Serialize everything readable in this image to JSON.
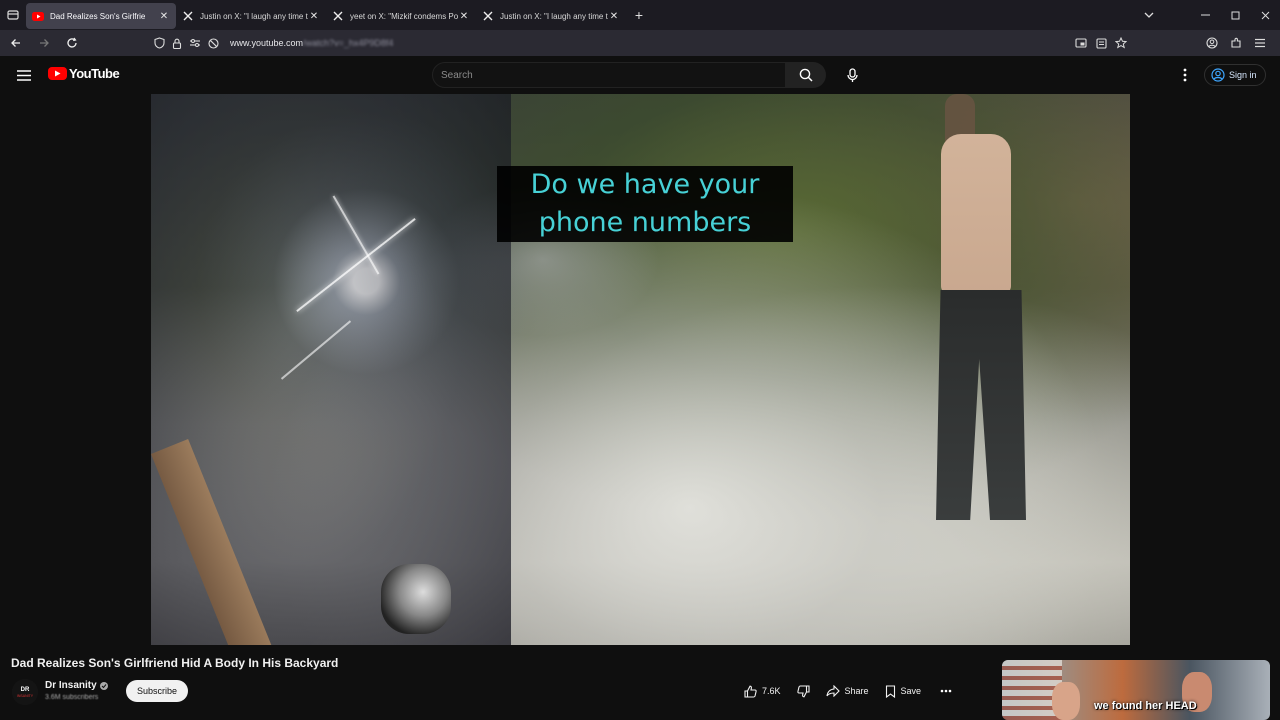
{
  "browser": {
    "tabs": [
      {
        "title": "Dad Realizes Son's Girlfrie",
        "favicon": "youtube-icon",
        "active": true
      },
      {
        "title": "Justin on X: \"I laugh any time tl",
        "favicon": "x-icon",
        "active": false
      },
      {
        "title": "yeet on X: \"Mizkif condems Poli",
        "favicon": "x-icon",
        "active": false
      },
      {
        "title": "Justin on X: \"I laugh any time tl",
        "favicon": "x-icon",
        "active": false
      }
    ],
    "url_host": "www.youtube.com",
    "url_path": "/watch?v=_hx4P9D8f4"
  },
  "youtube": {
    "logo_text": "YouTube",
    "search_placeholder": "Search",
    "signin_label": "Sign in"
  },
  "video": {
    "caption_line1": "Do we have your",
    "caption_line2": "phone numbers"
  },
  "watch": {
    "title": "Dad Realizes Son's Girlfriend Hid A Body In His Backyard",
    "channel_name": "Dr Insanity",
    "avatar_text": "DR\nINSANITY",
    "subscribers": "3.6M subscribers",
    "subscribe_label": "Subscribe",
    "likes": "7.6K",
    "share_label": "Share",
    "save_label": "Save",
    "next_thumb_text": "we found her HEAD"
  },
  "colors": {
    "accent": "#ff0000",
    "caption_text": "#47d1d6",
    "signin": "#3ea6ff",
    "bg": "#0f0f0f"
  }
}
